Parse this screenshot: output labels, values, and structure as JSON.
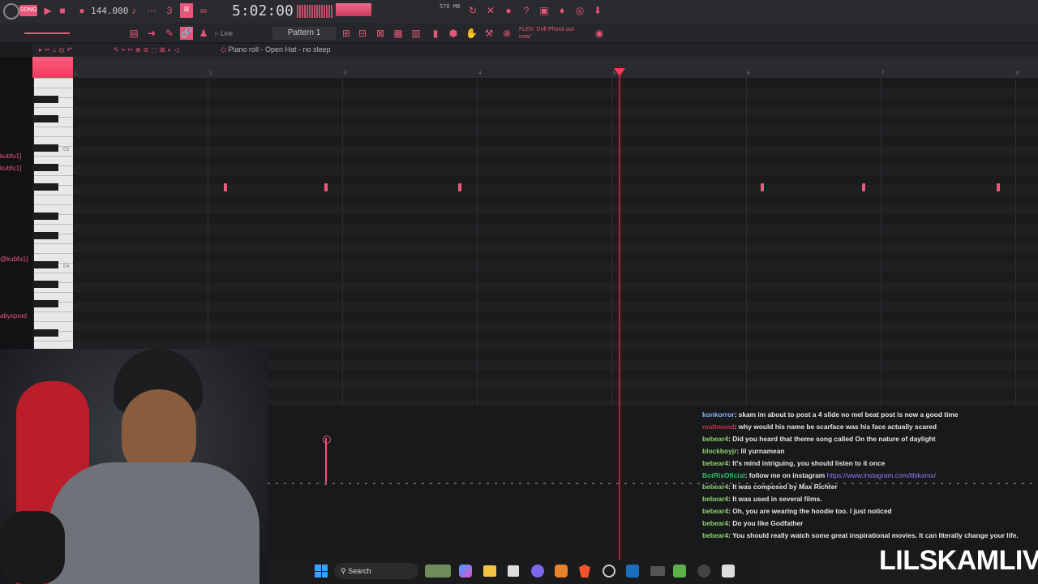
{
  "toolbar": {
    "tempo": "144.000",
    "time": "5:02:00",
    "memory": "570 MB",
    "snap": "Line",
    "pattern": "Pattern 1",
    "hint": "FLEX: Drift Phonk out now!"
  },
  "pianoroll": {
    "title": "Piano roll - Open Hat - no sleep",
    "ruler": [
      "1",
      "2",
      "3",
      "4",
      "5",
      "6",
      "7",
      "8"
    ],
    "octave_labels": [
      "E5",
      "E4"
    ]
  },
  "left_names": [
    "kubfu1]",
    "kubfu1]",
    "@kubfu1]",
    "abyxprod"
  ],
  "chat": [
    {
      "user": "konkorror",
      "text": ": skam im about to post a 4 slide no mel beat post is now a good time",
      "color": "#8fb0ff"
    },
    {
      "user": "mattwood",
      "text": ": why would his name be scarface was his face actually scared",
      "color": "#c0304d"
    },
    {
      "user": "bebear4",
      "text": ": Did you heard that theme song called On the nature of daylight",
      "color": "#8fd36b"
    },
    {
      "user": "blockboyjr",
      "text": ": lil yurnamean",
      "color": "#8fd36b"
    },
    {
      "user": "bebear4",
      "text": ": It's mind intriguing, you should listen to it once",
      "color": "#8fd36b"
    },
    {
      "user": "BotRixOficial",
      "text": ": follow me on instagram ",
      "link": "https://www.instagram.com/lilskamx/",
      "color": "#2fbf6a"
    },
    {
      "user": "bebear4",
      "text": ": It was composed by Max Richter",
      "color": "#8fd36b"
    },
    {
      "user": "bebear4",
      "text": ": It was used in several films.",
      "color": "#8fd36b"
    },
    {
      "user": "bebear4",
      "text": ": Oh, you are wearing the hoodie too. I just noticed",
      "color": "#8fd36b"
    },
    {
      "user": "bebear4",
      "text": ": Do you like Godfather",
      "color": "#8fd36b"
    },
    {
      "user": "bebear4",
      "text": ": You should really watch some great inspirational movies. It can literally change your life.",
      "color": "#8fd36b"
    }
  ],
  "taskbar": {
    "search": "Search"
  },
  "watermark": "LILSKAMLIVE"
}
